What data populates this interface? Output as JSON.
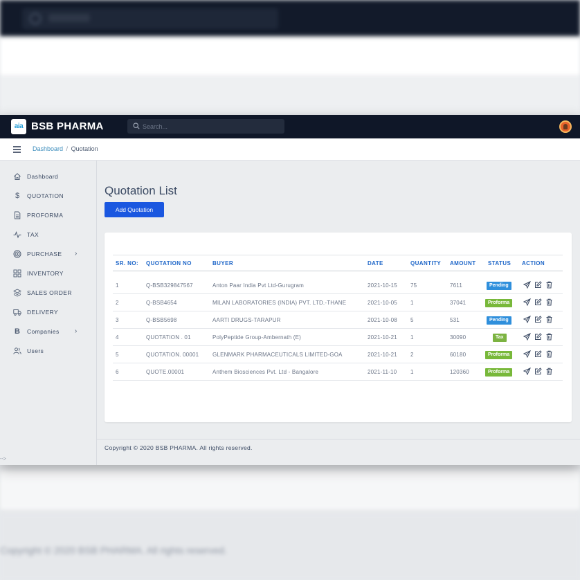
{
  "app": {
    "brand": "BSB PHARMA",
    "logo_text": "aia"
  },
  "search": {
    "placeholder": "Search..."
  },
  "breadcrumb": {
    "root": "Dashboard",
    "separator": "/",
    "current": "Quotation"
  },
  "sidebar": {
    "items": [
      {
        "label": "Dashboard",
        "icon": "home-icon",
        "has_submenu": false
      },
      {
        "label": "QUOTATION",
        "icon": "dollar-icon",
        "has_submenu": false
      },
      {
        "label": "PROFORMA",
        "icon": "document-icon",
        "has_submenu": false
      },
      {
        "label": "TAX",
        "icon": "pulse-icon",
        "has_submenu": false
      },
      {
        "label": "PURCHASE",
        "icon": "target-icon",
        "has_submenu": true
      },
      {
        "label": "INVENTORY",
        "icon": "grid-icon",
        "has_submenu": false
      },
      {
        "label": "SALES ORDER",
        "icon": "layers-icon",
        "has_submenu": false
      },
      {
        "label": "DELIVERY",
        "icon": "truck-icon",
        "has_submenu": false
      },
      {
        "label": "Companies",
        "icon": "bold-b-icon",
        "has_submenu": true
      },
      {
        "label": "Users",
        "icon": "users-icon",
        "has_submenu": false
      }
    ]
  },
  "main": {
    "title": "Quotation List",
    "add_button": "Add Quotation"
  },
  "table": {
    "columns": [
      "SR. NO:",
      "QUOTATION NO",
      "BUYER",
      "DATE",
      "QUANTITY",
      "AMOUNT",
      "STATUS",
      "ACTION"
    ],
    "rows": [
      {
        "sr": "1",
        "quotation_no": "Q-BSB329847567",
        "buyer": "Anton Paar India Pvt Ltd-Gurugram",
        "date": "2021-10-15",
        "quantity": "75",
        "amount": "7611",
        "status": "Pending"
      },
      {
        "sr": "2",
        "quotation_no": "Q-BSB4654",
        "buyer": "MILAN LABORATORIES (INDIA) PVT. LTD.-THANE",
        "date": "2021-10-05",
        "quantity": "1",
        "amount": "37041",
        "status": "Proforma"
      },
      {
        "sr": "3",
        "quotation_no": "Q-BSB5698",
        "buyer": "AARTI DRUGS-TARAPUR",
        "date": "2021-10-08",
        "quantity": "5",
        "amount": "531",
        "status": "Pending"
      },
      {
        "sr": "4",
        "quotation_no": "QUOTATION . 01",
        "buyer": "PolyPeptide Group-Ambernath (E)",
        "date": "2021-10-21",
        "quantity": "1",
        "amount": "30090",
        "status": "Tax"
      },
      {
        "sr": "5",
        "quotation_no": "QUOTATION. 00001",
        "buyer": "GLENMARK PHARMACEUTICALS LIMITED-GOA",
        "date": "2021-10-21",
        "quantity": "2",
        "amount": "60180",
        "status": "Proforma"
      },
      {
        "sr": "6",
        "quotation_no": "QUOTE.00001",
        "buyer": "Anthem Biosciences Pvt. Ltd - Bangalore",
        "date": "2021-11-10",
        "quantity": "1",
        "amount": "120360",
        "status": "Proforma"
      }
    ]
  },
  "status_colors": {
    "Pending": "#2f8fdc",
    "Proforma": "#78b83a",
    "Tax": "#7cb342"
  },
  "action_icons": [
    "send-icon",
    "edit-icon",
    "trash-icon"
  ],
  "footer": {
    "copyright": "Copyright © 2020 BSB PHARMA. All rights reserved."
  },
  "corner_mark": "-->"
}
